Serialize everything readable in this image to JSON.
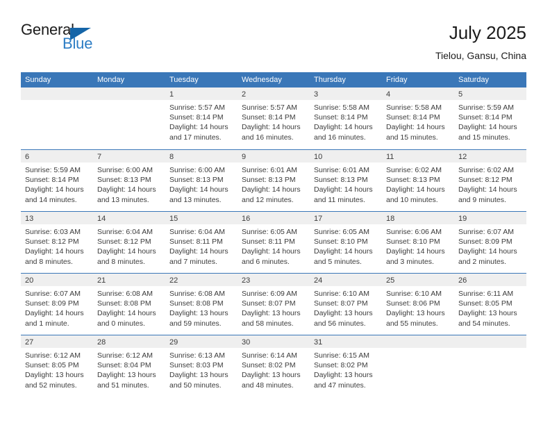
{
  "logo": {
    "word_one": "General",
    "word_two": "Blue",
    "triangle_color": "#1565a8",
    "blue_text_color": "#2b7cc4"
  },
  "header": {
    "title": "July 2025",
    "subtitle": "Tielou, Gansu, China",
    "accent_color": "#3a77b8",
    "band_color": "#efefef"
  },
  "weekdays": [
    "Sunday",
    "Monday",
    "Tuesday",
    "Wednesday",
    "Thursday",
    "Friday",
    "Saturday"
  ],
  "weeks": [
    [
      {
        "day": "",
        "sunrise": "",
        "sunset": "",
        "daylight": ""
      },
      {
        "day": "",
        "sunrise": "",
        "sunset": "",
        "daylight": ""
      },
      {
        "day": "1",
        "sunrise": "Sunrise: 5:57 AM",
        "sunset": "Sunset: 8:14 PM",
        "daylight": "Daylight: 14 hours and 17 minutes."
      },
      {
        "day": "2",
        "sunrise": "Sunrise: 5:57 AM",
        "sunset": "Sunset: 8:14 PM",
        "daylight": "Daylight: 14 hours and 16 minutes."
      },
      {
        "day": "3",
        "sunrise": "Sunrise: 5:58 AM",
        "sunset": "Sunset: 8:14 PM",
        "daylight": "Daylight: 14 hours and 16 minutes."
      },
      {
        "day": "4",
        "sunrise": "Sunrise: 5:58 AM",
        "sunset": "Sunset: 8:14 PM",
        "daylight": "Daylight: 14 hours and 15 minutes."
      },
      {
        "day": "5",
        "sunrise": "Sunrise: 5:59 AM",
        "sunset": "Sunset: 8:14 PM",
        "daylight": "Daylight: 14 hours and 15 minutes."
      }
    ],
    [
      {
        "day": "6",
        "sunrise": "Sunrise: 5:59 AM",
        "sunset": "Sunset: 8:14 PM",
        "daylight": "Daylight: 14 hours and 14 minutes."
      },
      {
        "day": "7",
        "sunrise": "Sunrise: 6:00 AM",
        "sunset": "Sunset: 8:13 PM",
        "daylight": "Daylight: 14 hours and 13 minutes."
      },
      {
        "day": "8",
        "sunrise": "Sunrise: 6:00 AM",
        "sunset": "Sunset: 8:13 PM",
        "daylight": "Daylight: 14 hours and 13 minutes."
      },
      {
        "day": "9",
        "sunrise": "Sunrise: 6:01 AM",
        "sunset": "Sunset: 8:13 PM",
        "daylight": "Daylight: 14 hours and 12 minutes."
      },
      {
        "day": "10",
        "sunrise": "Sunrise: 6:01 AM",
        "sunset": "Sunset: 8:13 PM",
        "daylight": "Daylight: 14 hours and 11 minutes."
      },
      {
        "day": "11",
        "sunrise": "Sunrise: 6:02 AM",
        "sunset": "Sunset: 8:13 PM",
        "daylight": "Daylight: 14 hours and 10 minutes."
      },
      {
        "day": "12",
        "sunrise": "Sunrise: 6:02 AM",
        "sunset": "Sunset: 8:12 PM",
        "daylight": "Daylight: 14 hours and 9 minutes."
      }
    ],
    [
      {
        "day": "13",
        "sunrise": "Sunrise: 6:03 AM",
        "sunset": "Sunset: 8:12 PM",
        "daylight": "Daylight: 14 hours and 8 minutes."
      },
      {
        "day": "14",
        "sunrise": "Sunrise: 6:04 AM",
        "sunset": "Sunset: 8:12 PM",
        "daylight": "Daylight: 14 hours and 8 minutes."
      },
      {
        "day": "15",
        "sunrise": "Sunrise: 6:04 AM",
        "sunset": "Sunset: 8:11 PM",
        "daylight": "Daylight: 14 hours and 7 minutes."
      },
      {
        "day": "16",
        "sunrise": "Sunrise: 6:05 AM",
        "sunset": "Sunset: 8:11 PM",
        "daylight": "Daylight: 14 hours and 6 minutes."
      },
      {
        "day": "17",
        "sunrise": "Sunrise: 6:05 AM",
        "sunset": "Sunset: 8:10 PM",
        "daylight": "Daylight: 14 hours and 5 minutes."
      },
      {
        "day": "18",
        "sunrise": "Sunrise: 6:06 AM",
        "sunset": "Sunset: 8:10 PM",
        "daylight": "Daylight: 14 hours and 3 minutes."
      },
      {
        "day": "19",
        "sunrise": "Sunrise: 6:07 AM",
        "sunset": "Sunset: 8:09 PM",
        "daylight": "Daylight: 14 hours and 2 minutes."
      }
    ],
    [
      {
        "day": "20",
        "sunrise": "Sunrise: 6:07 AM",
        "sunset": "Sunset: 8:09 PM",
        "daylight": "Daylight: 14 hours and 1 minute."
      },
      {
        "day": "21",
        "sunrise": "Sunrise: 6:08 AM",
        "sunset": "Sunset: 8:08 PM",
        "daylight": "Daylight: 14 hours and 0 minutes."
      },
      {
        "day": "22",
        "sunrise": "Sunrise: 6:08 AM",
        "sunset": "Sunset: 8:08 PM",
        "daylight": "Daylight: 13 hours and 59 minutes."
      },
      {
        "day": "23",
        "sunrise": "Sunrise: 6:09 AM",
        "sunset": "Sunset: 8:07 PM",
        "daylight": "Daylight: 13 hours and 58 minutes."
      },
      {
        "day": "24",
        "sunrise": "Sunrise: 6:10 AM",
        "sunset": "Sunset: 8:07 PM",
        "daylight": "Daylight: 13 hours and 56 minutes."
      },
      {
        "day": "25",
        "sunrise": "Sunrise: 6:10 AM",
        "sunset": "Sunset: 8:06 PM",
        "daylight": "Daylight: 13 hours and 55 minutes."
      },
      {
        "day": "26",
        "sunrise": "Sunrise: 6:11 AM",
        "sunset": "Sunset: 8:05 PM",
        "daylight": "Daylight: 13 hours and 54 minutes."
      }
    ],
    [
      {
        "day": "27",
        "sunrise": "Sunrise: 6:12 AM",
        "sunset": "Sunset: 8:05 PM",
        "daylight": "Daylight: 13 hours and 52 minutes."
      },
      {
        "day": "28",
        "sunrise": "Sunrise: 6:12 AM",
        "sunset": "Sunset: 8:04 PM",
        "daylight": "Daylight: 13 hours and 51 minutes."
      },
      {
        "day": "29",
        "sunrise": "Sunrise: 6:13 AM",
        "sunset": "Sunset: 8:03 PM",
        "daylight": "Daylight: 13 hours and 50 minutes."
      },
      {
        "day": "30",
        "sunrise": "Sunrise: 6:14 AM",
        "sunset": "Sunset: 8:02 PM",
        "daylight": "Daylight: 13 hours and 48 minutes."
      },
      {
        "day": "31",
        "sunrise": "Sunrise: 6:15 AM",
        "sunset": "Sunset: 8:02 PM",
        "daylight": "Daylight: 13 hours and 47 minutes."
      },
      {
        "day": "",
        "sunrise": "",
        "sunset": "",
        "daylight": ""
      },
      {
        "day": "",
        "sunrise": "",
        "sunset": "",
        "daylight": ""
      }
    ]
  ]
}
